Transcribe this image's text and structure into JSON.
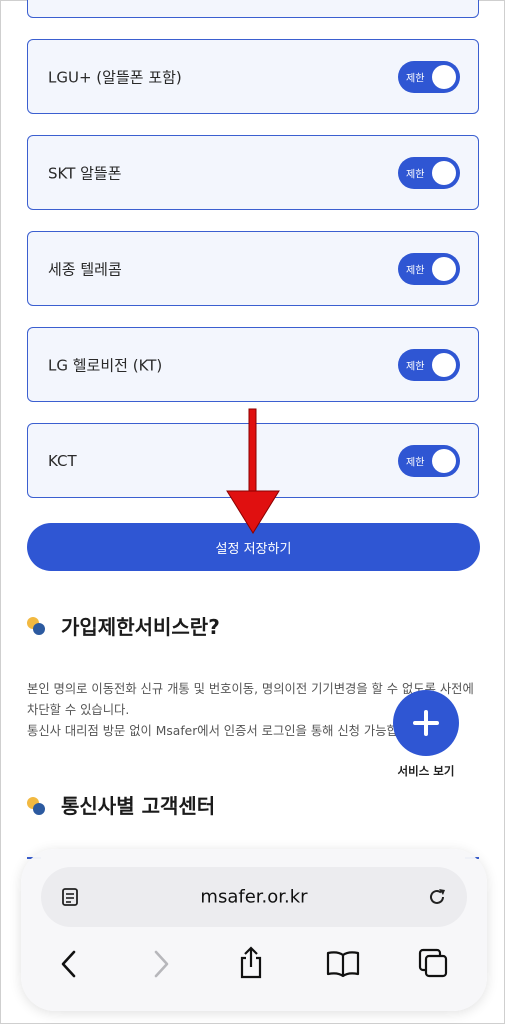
{
  "carriers": [
    {
      "label": "LGU+ (알뜰폰 포함)",
      "toggle_text": "제한"
    },
    {
      "label": "SKT 알뜰폰",
      "toggle_text": "제한"
    },
    {
      "label": "세종 텔레콤",
      "toggle_text": "제한"
    },
    {
      "label": "LG 헬로비전 (KT)",
      "toggle_text": "제한"
    },
    {
      "label": "KCT",
      "toggle_text": "제한"
    }
  ],
  "save_button": "설정 저장하기",
  "section1": {
    "title": "가입제한서비스란?",
    "desc1": "본인 명의로 이동전화 신규 개통 및 번호이동, 명의이전 기기변경을 할 수 없도록 사전에 차단할 수 있습니다.",
    "desc2": "통신사 대리점 방문 없이 Msafer에서 인증서 로그인을 통해 신청 가능합니다."
  },
  "fab": {
    "label": "서비스 보기"
  },
  "section2": {
    "title": "통신사별 고객센터"
  },
  "browser": {
    "url": "msafer.or.kr"
  },
  "colors": {
    "accent": "#2f56d3",
    "card_bg": "#f3f6fd",
    "arrow": "#e01010"
  }
}
